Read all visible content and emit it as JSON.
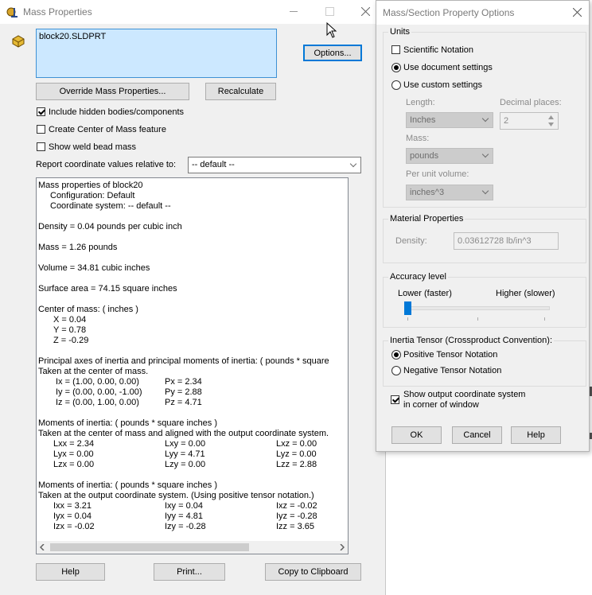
{
  "mass_properties": {
    "title": "Mass Properties",
    "file_name": "block20.SLDPRT",
    "options_label": "Options...",
    "override_label": "Override Mass Properties...",
    "recalculate_label": "Recalculate",
    "include_hidden_label": "Include hidden bodies/components",
    "create_com_label": "Create Center of Mass feature",
    "show_weld_label": "Show weld bead mass",
    "report_coord_label": "Report coordinate values relative to:",
    "coord_value": "-- default --",
    "help_label": "Help",
    "print_label": "Print...",
    "copy_label": "Copy to Clipboard",
    "results": {
      "heading": "Mass properties of block20",
      "configuration": "Configuration: Default",
      "coord_system": "Coordinate system: -- default --",
      "density": "Density = 0.04 pounds per cubic inch",
      "mass": "Mass = 1.26 pounds",
      "volume": "Volume = 34.81 cubic inches",
      "surface_area": "Surface area = 74.15 square inches",
      "com_heading": "Center of mass: ( inches )",
      "com_x": "X = 0.04",
      "com_y": "Y = 0.78",
      "com_z": "Z = -0.29",
      "principal_heading": "Principal axes of inertia and principal moments of inertia: ( pounds * square",
      "principal_sub": "Taken at the center of mass.",
      "ix": "Ix = (1.00,  0.00,  0.00)",
      "iy": "Iy = (0.00,  0.00, -1.00)",
      "iz": "Iz = (0.00,  1.00,  0.00)",
      "px": "Px = 2.34",
      "py": "Py = 2.88",
      "pz": "Pz = 4.71",
      "moments1_heading": "Moments of inertia: ( pounds * square inches )",
      "moments1_sub": "Taken at the center of mass and aligned with the output coordinate system.",
      "lxx": "Lxx = 2.34",
      "lxy": "Lxy = 0.00",
      "lxz": "Lxz = 0.00",
      "lyx": "Lyx = 0.00",
      "lyy": "Lyy = 4.71",
      "lyz": "Lyz = 0.00",
      "lzx": "Lzx = 0.00",
      "lzy": "Lzy = 0.00",
      "lzz": "Lzz = 2.88",
      "moments2_heading": "Moments of inertia: ( pounds * square inches )",
      "moments2_sub": "Taken at the output coordinate system. (Using positive tensor notation.)",
      "ixx": "Ixx = 3.21",
      "ixy": "Ixy = 0.04",
      "ixz": "Ixz = -0.02",
      "iyx": "Iyx = 0.04",
      "iyy": "Iyy = 4.81",
      "iyz": "Iyz = -0.28",
      "izx": "Izx = -0.02",
      "izy": "Izy = -0.28",
      "izz": "Izz = 3.65"
    }
  },
  "options": {
    "title": "Mass/Section Property Options",
    "units_title": "Units",
    "scientific_label": "Scientific Notation",
    "use_document_label": "Use document settings",
    "use_custom_label": "Use custom settings",
    "length_label": "Length:",
    "length_value": "Inches",
    "decimal_label": "Decimal places:",
    "decimal_value": "2",
    "mass_label": "Mass:",
    "mass_value": "pounds",
    "per_unit_label": "Per unit volume:",
    "per_unit_value": "inches^3",
    "material_title": "Material Properties",
    "density_label": "Density:",
    "density_value": "0.03612728 lb/in^3",
    "accuracy_title": "Accuracy level",
    "lower_label": "Lower (faster)",
    "higher_label": "Higher (slower)",
    "inertia_title": "Inertia Tensor (Crossproduct Convention):",
    "positive_label": "Positive Tensor Notation",
    "negative_label": "Negative Tensor Notation",
    "show_output_label1": "Show output coordinate system",
    "show_output_label2": "in corner of window",
    "ok_label": "OK",
    "cancel_label": "Cancel",
    "help_label": "Help"
  }
}
